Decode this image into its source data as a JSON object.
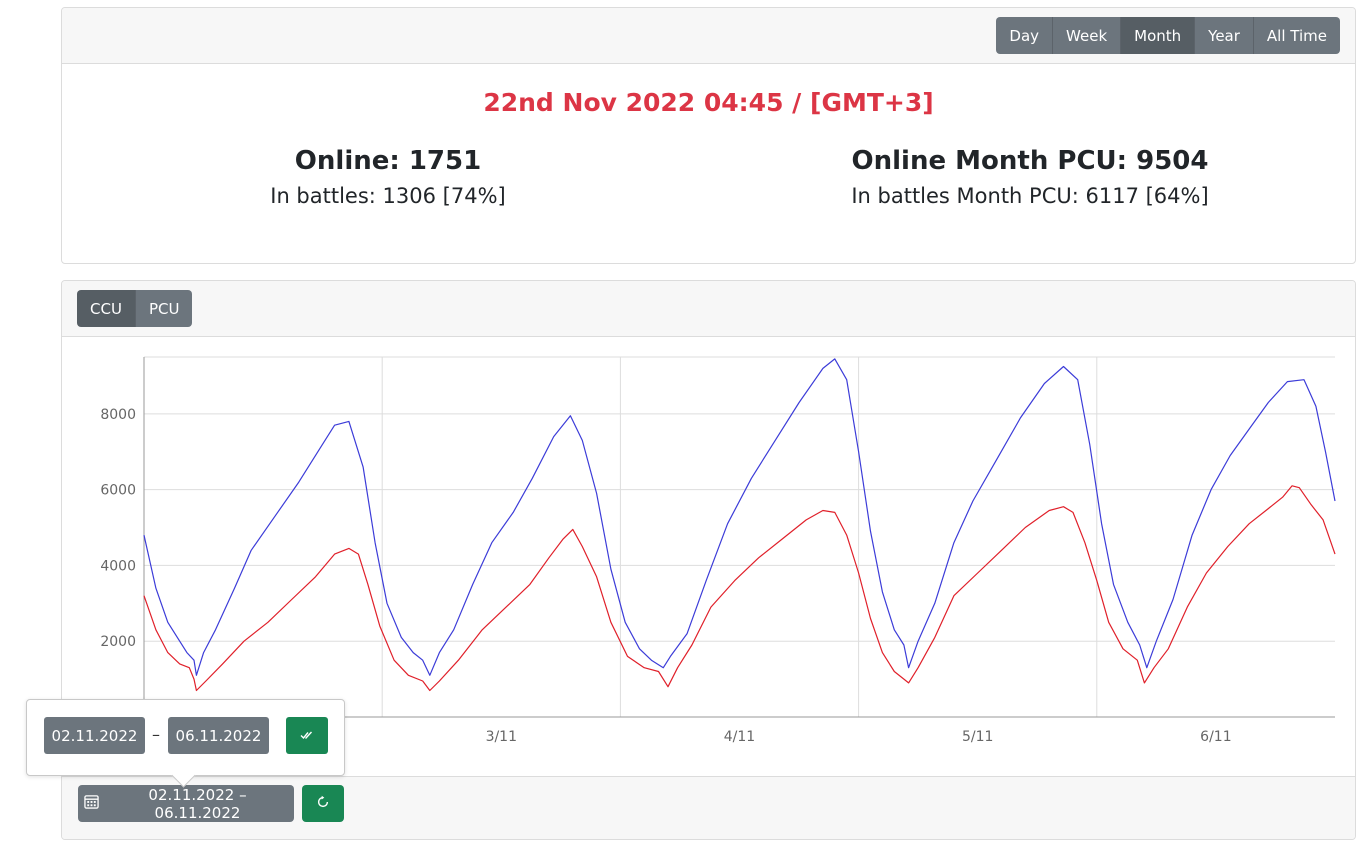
{
  "range_buttons": [
    "Day",
    "Week",
    "Month",
    "Year",
    "All Time"
  ],
  "range_active": "Month",
  "summary": {
    "datetime": "22nd Nov 2022 04:45 / [GMT+3]",
    "online": "Online: 1751",
    "in_battles": "In battles: 1306 [74%]",
    "month_pcu": "Online Month PCU: 9504",
    "month_battles_pcu": "In battles Month PCU: 6117 [64%]"
  },
  "metric_buttons": [
    "CCU",
    "PCU"
  ],
  "metric_active": "CCU",
  "footer": {
    "date_range": "02.11.2022 – 06.11.2022"
  },
  "popover": {
    "from": "02.11.2022",
    "to": "06.11.2022",
    "separator": "–"
  },
  "colors": {
    "online": "#3c3cd8",
    "battles": "#e0202a",
    "accent": "#dc3545",
    "success": "#198754",
    "button": "#6c757d"
  },
  "icons": [
    "calendar-icon",
    "refresh-icon",
    "double-check-icon"
  ],
  "chart_data": {
    "type": "line",
    "x_ticks": [
      "3/11",
      "4/11",
      "5/11",
      "6/11"
    ],
    "y_ticks": [
      2000,
      4000,
      6000,
      8000
    ],
    "xlim": [
      2.0,
      7.0
    ],
    "ylim": [
      0,
      9500
    ],
    "grid": true,
    "series": [
      {
        "color": "#3c3cd8",
        "points": [
          [
            2.0,
            4800
          ],
          [
            2.05,
            3400
          ],
          [
            2.1,
            2500
          ],
          [
            2.15,
            2000
          ],
          [
            2.18,
            1700
          ],
          [
            2.21,
            1500
          ],
          [
            2.22,
            1100
          ],
          [
            2.25,
            1700
          ],
          [
            2.3,
            2300
          ],
          [
            2.38,
            3400
          ],
          [
            2.45,
            4400
          ],
          [
            2.55,
            5300
          ],
          [
            2.65,
            6200
          ],
          [
            2.75,
            7200
          ],
          [
            2.8,
            7700
          ],
          [
            2.86,
            7800
          ],
          [
            2.92,
            6600
          ],
          [
            2.97,
            4600
          ],
          [
            3.02,
            3000
          ],
          [
            3.08,
            2100
          ],
          [
            3.13,
            1700
          ],
          [
            3.17,
            1500
          ],
          [
            3.2,
            1100
          ],
          [
            3.24,
            1700
          ],
          [
            3.3,
            2300
          ],
          [
            3.38,
            3500
          ],
          [
            3.46,
            4600
          ],
          [
            3.55,
            5400
          ],
          [
            3.63,
            6300
          ],
          [
            3.72,
            7400
          ],
          [
            3.79,
            7950
          ],
          [
            3.84,
            7300
          ],
          [
            3.9,
            5900
          ],
          [
            3.96,
            3900
          ],
          [
            4.02,
            2500
          ],
          [
            4.08,
            1800
          ],
          [
            4.13,
            1500
          ],
          [
            4.18,
            1300
          ],
          [
            4.21,
            1600
          ],
          [
            4.28,
            2200
          ],
          [
            4.36,
            3600
          ],
          [
            4.45,
            5100
          ],
          [
            4.55,
            6300
          ],
          [
            4.65,
            7300
          ],
          [
            4.75,
            8300
          ],
          [
            4.85,
            9200
          ],
          [
            4.9,
            9450
          ],
          [
            4.95,
            8900
          ],
          [
            5.0,
            7000
          ],
          [
            5.05,
            4900
          ],
          [
            5.1,
            3300
          ],
          [
            5.15,
            2300
          ],
          [
            5.19,
            1900
          ],
          [
            5.21,
            1300
          ],
          [
            5.25,
            2000
          ],
          [
            5.32,
            3000
          ],
          [
            5.4,
            4600
          ],
          [
            5.48,
            5700
          ],
          [
            5.58,
            6800
          ],
          [
            5.68,
            7900
          ],
          [
            5.78,
            8800
          ],
          [
            5.86,
            9250
          ],
          [
            5.92,
            8900
          ],
          [
            5.97,
            7200
          ],
          [
            6.02,
            5100
          ],
          [
            6.07,
            3500
          ],
          [
            6.13,
            2500
          ],
          [
            6.18,
            1900
          ],
          [
            6.21,
            1300
          ],
          [
            6.25,
            2000
          ],
          [
            6.32,
            3100
          ],
          [
            6.4,
            4800
          ],
          [
            6.48,
            6000
          ],
          [
            6.56,
            6900
          ],
          [
            6.64,
            7600
          ],
          [
            6.72,
            8300
          ],
          [
            6.8,
            8850
          ],
          [
            6.87,
            8900
          ],
          [
            6.92,
            8200
          ],
          [
            6.96,
            7000
          ],
          [
            7.0,
            5700
          ]
        ]
      },
      {
        "color": "#e0202a",
        "points": [
          [
            2.0,
            3200
          ],
          [
            2.05,
            2300
          ],
          [
            2.1,
            1700
          ],
          [
            2.15,
            1400
          ],
          [
            2.19,
            1300
          ],
          [
            2.21,
            1000
          ],
          [
            2.22,
            700
          ],
          [
            2.26,
            950
          ],
          [
            2.33,
            1400
          ],
          [
            2.42,
            2000
          ],
          [
            2.52,
            2500
          ],
          [
            2.62,
            3100
          ],
          [
            2.72,
            3700
          ],
          [
            2.8,
            4300
          ],
          [
            2.86,
            4450
          ],
          [
            2.9,
            4300
          ],
          [
            2.94,
            3500
          ],
          [
            2.99,
            2400
          ],
          [
            3.05,
            1500
          ],
          [
            3.11,
            1100
          ],
          [
            3.17,
            950
          ],
          [
            3.2,
            700
          ],
          [
            3.24,
            950
          ],
          [
            3.32,
            1500
          ],
          [
            3.42,
            2300
          ],
          [
            3.52,
            2900
          ],
          [
            3.62,
            3500
          ],
          [
            3.7,
            4200
          ],
          [
            3.76,
            4700
          ],
          [
            3.8,
            4950
          ],
          [
            3.84,
            4500
          ],
          [
            3.9,
            3700
          ],
          [
            3.96,
            2500
          ],
          [
            4.03,
            1600
          ],
          [
            4.1,
            1300
          ],
          [
            4.16,
            1200
          ],
          [
            4.2,
            800
          ],
          [
            4.24,
            1300
          ],
          [
            4.3,
            1900
          ],
          [
            4.38,
            2900
          ],
          [
            4.48,
            3600
          ],
          [
            4.58,
            4200
          ],
          [
            4.68,
            4700
          ],
          [
            4.78,
            5200
          ],
          [
            4.85,
            5450
          ],
          [
            4.9,
            5400
          ],
          [
            4.95,
            4800
          ],
          [
            5.0,
            3800
          ],
          [
            5.05,
            2600
          ],
          [
            5.1,
            1700
          ],
          [
            5.15,
            1200
          ],
          [
            5.19,
            1000
          ],
          [
            5.21,
            900
          ],
          [
            5.25,
            1300
          ],
          [
            5.32,
            2100
          ],
          [
            5.4,
            3200
          ],
          [
            5.5,
            3800
          ],
          [
            5.6,
            4400
          ],
          [
            5.7,
            5000
          ],
          [
            5.8,
            5450
          ],
          [
            5.86,
            5550
          ],
          [
            5.9,
            5400
          ],
          [
            5.95,
            4600
          ],
          [
            6.0,
            3600
          ],
          [
            6.05,
            2500
          ],
          [
            6.11,
            1800
          ],
          [
            6.17,
            1500
          ],
          [
            6.2,
            900
          ],
          [
            6.24,
            1300
          ],
          [
            6.3,
            1800
          ],
          [
            6.38,
            2900
          ],
          [
            6.46,
            3800
          ],
          [
            6.55,
            4500
          ],
          [
            6.64,
            5100
          ],
          [
            6.72,
            5500
          ],
          [
            6.78,
            5800
          ],
          [
            6.82,
            6100
          ],
          [
            6.85,
            6050
          ],
          [
            6.9,
            5600
          ],
          [
            6.95,
            5200
          ],
          [
            7.0,
            4300
          ]
        ]
      }
    ]
  }
}
